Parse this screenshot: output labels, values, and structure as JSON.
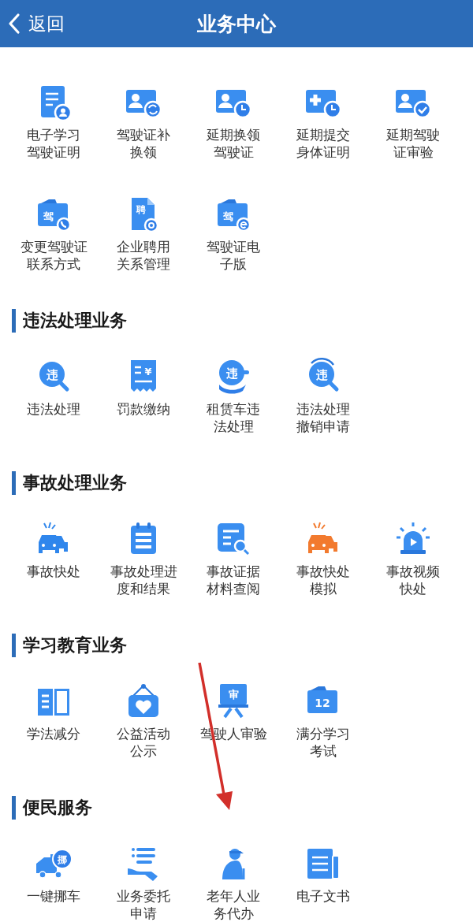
{
  "header": {
    "back": "返回",
    "title": "业务中心"
  },
  "sections": [
    {
      "items": [
        {
          "label": "电子学习驾驶证明",
          "kind": "doc-person"
        },
        {
          "label": "驾驶证补换领",
          "kind": "card-swap"
        },
        {
          "label": "延期换领驾驶证",
          "kind": "card-clock"
        },
        {
          "label": "延期提交身体证明",
          "kind": "plus-clock"
        },
        {
          "label": "延期驾驶证审验",
          "kind": "card-check"
        },
        {
          "label": "变更驾驶证联系方式",
          "kind": "card-phone",
          "badge": "驾"
        },
        {
          "label": "企业聘用关系管理",
          "kind": "doc-gear",
          "badge": "聘"
        },
        {
          "label": "驾驶证电子版",
          "kind": "card-e",
          "badge": "驾"
        }
      ]
    },
    {
      "title": "违法处理业务",
      "items": [
        {
          "label": "违法处理",
          "kind": "magnifier",
          "badge": "违"
        },
        {
          "label": "罚款缴纳",
          "kind": "receipt",
          "badge": "¥"
        },
        {
          "label": "租赁车违法处理",
          "kind": "hand-bubble",
          "badge": "违"
        },
        {
          "label": "违法处理撤销申请",
          "kind": "undo-magnifier",
          "badge": "违"
        }
      ]
    },
    {
      "title": "事故处理业务",
      "items": [
        {
          "label": "事故快处",
          "kind": "cars",
          "color": "#2f86ec"
        },
        {
          "label": "事故处理进度和结果",
          "kind": "calendar-list"
        },
        {
          "label": "事故证据材料查阅",
          "kind": "doc-search"
        },
        {
          "label": "事故快处模拟",
          "kind": "cars",
          "color": "#f27a2e"
        },
        {
          "label": "事故视频快处",
          "kind": "siren"
        }
      ]
    },
    {
      "title": "学习教育业务",
      "items": [
        {
          "label": "学法减分",
          "kind": "book"
        },
        {
          "label": "公益活动公示",
          "kind": "heart-sign"
        },
        {
          "label": "驾驶人审验",
          "kind": "easel",
          "badge": "审"
        },
        {
          "label": "满分学习考试",
          "kind": "card-number",
          "badge": "12"
        }
      ]
    },
    {
      "title": "便民服务",
      "items": [
        {
          "label": "一键挪车",
          "kind": "truck",
          "badge": "挪"
        },
        {
          "label": "业务委托申请",
          "kind": "hand-list"
        },
        {
          "label": "老年人业务代办",
          "kind": "elder"
        },
        {
          "label": "电子文书",
          "kind": "newspaper"
        }
      ]
    }
  ]
}
